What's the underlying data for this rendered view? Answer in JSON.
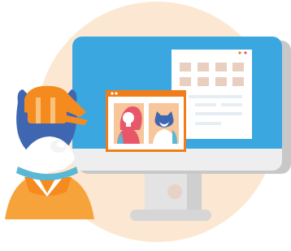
{
  "scene": {
    "description_free": true,
    "colors": {
      "background_circle": "#fce8d2",
      "screen_blue": "#3aa7e0",
      "monitor_bezel": "#eeeeee",
      "monitor_shadow": "#c9c9c9",
      "card_white": "#ffffff",
      "card_tiles": "#e9cfc0",
      "card_lines": "#e6eef3",
      "photo_frame_orange": "#f07d1a",
      "photo_bg": "#f7c69a",
      "character_navy": "#3f66b0",
      "character_skin_white": "#f4f4f4",
      "character_orange": "#f7a33b",
      "cap_orange": "#f58b1f",
      "hair_pink": "#e8566a",
      "shirt_teal": "#5ab7d5",
      "stand_gray": "#d9d9d9"
    },
    "icons": {
      "monitor": "desktop-monitor-icon",
      "mascot": "cat-mascot-with-cap",
      "photo": "profile-photos-window"
    }
  }
}
